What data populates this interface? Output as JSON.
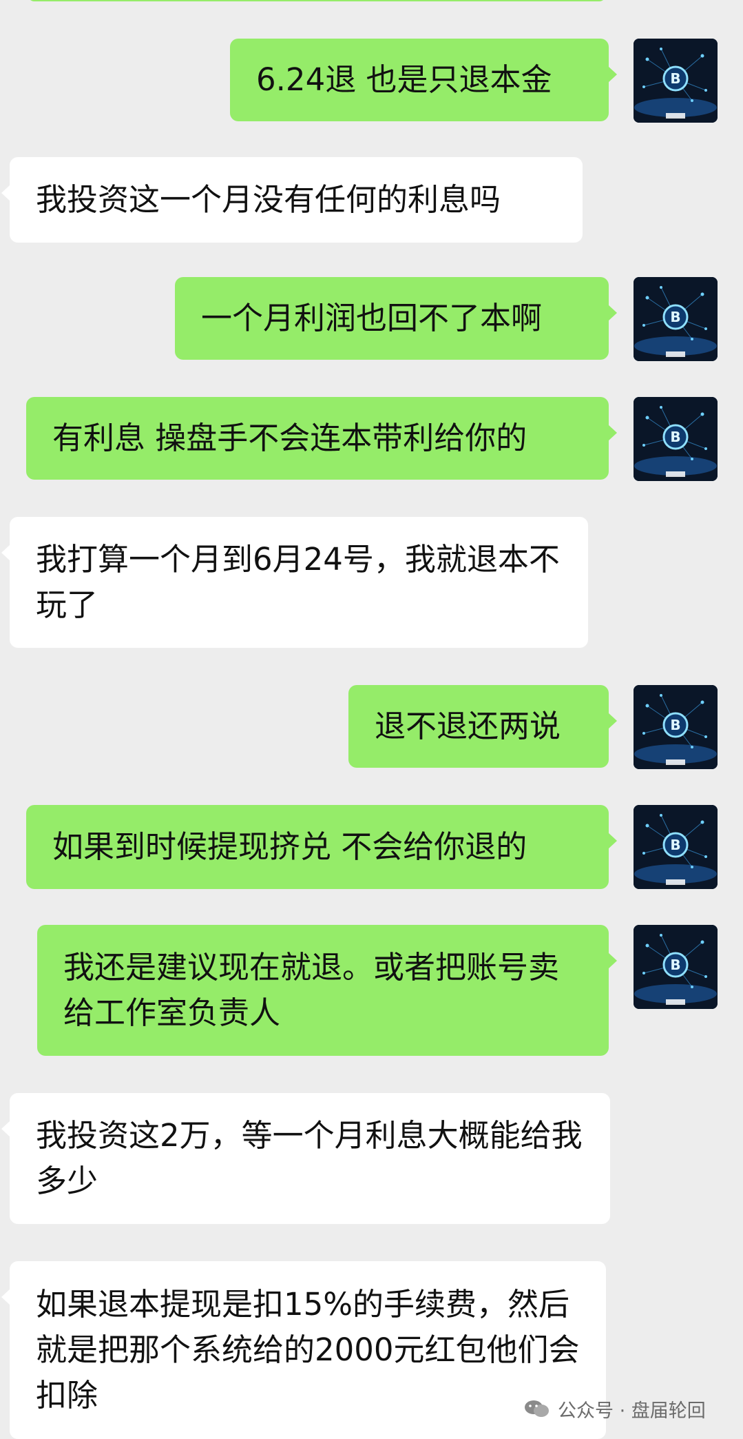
{
  "messages": [
    {
      "side": "right",
      "text": "6.24退 也是只退本金"
    },
    {
      "side": "left",
      "text": "我投资这一个月没有任何的利息吗"
    },
    {
      "side": "right",
      "text": "一个月利润也回不了本啊"
    },
    {
      "side": "right",
      "text": "有利息 操盘手不会连本带利给你的"
    },
    {
      "side": "left",
      "text": "我打算一个月到6月24号，我就退本不玩了"
    },
    {
      "side": "right",
      "text": "退不退还两说"
    },
    {
      "side": "right",
      "text": "如果到时候提现挤兑 不会给你退的"
    },
    {
      "side": "right",
      "text": "我还是建议现在就退。或者把账号卖给工作室负责人"
    },
    {
      "side": "left",
      "text": "我投资这2万，等一个月利息大概能给我多少"
    },
    {
      "side": "left",
      "text": "如果退本提现是扣15%的手续费，然后就是把那个系统给的2000元红包他们会扣除"
    }
  ],
  "watermark": {
    "text": "公众号 · 盘届轮回",
    "icon": "wechat-official-account-icon"
  },
  "avatar_icon": "bitcoin-network-avatar-icon",
  "colors": {
    "background": "#ededed",
    "right_bubble": "#95ec69",
    "left_bubble": "#ffffff",
    "text": "#111111"
  }
}
